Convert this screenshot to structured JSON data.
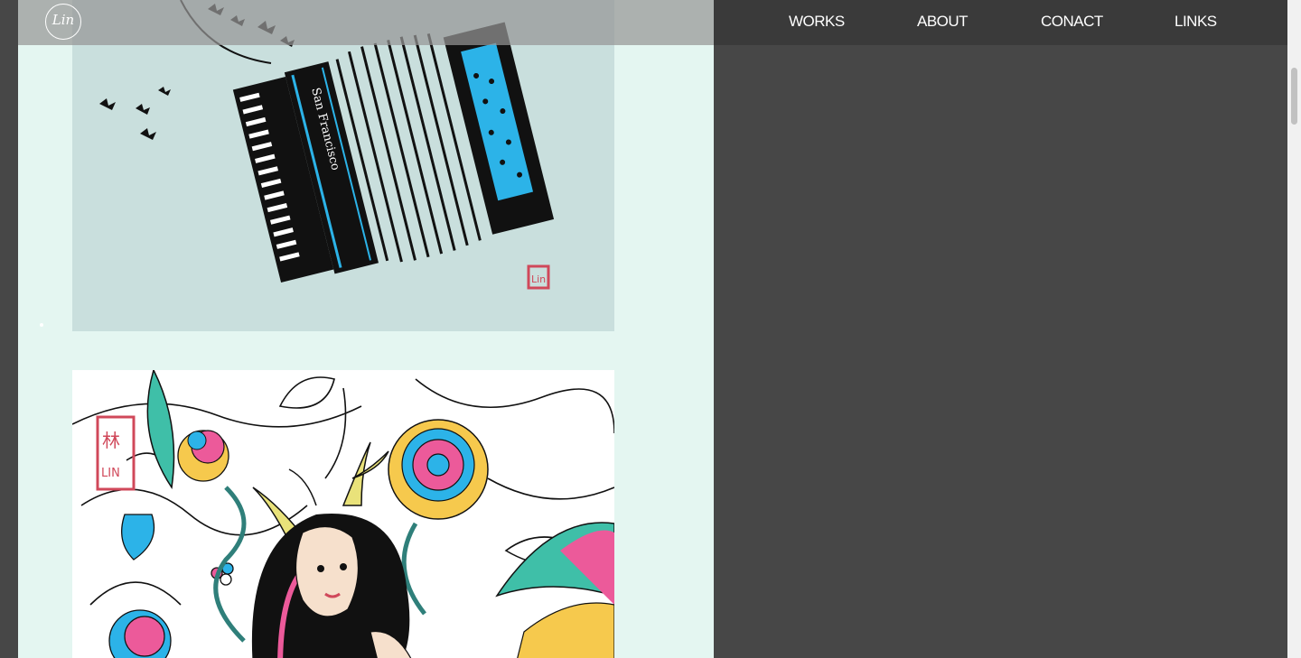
{
  "header": {
    "logo_text": "Lin",
    "nav": [
      {
        "label": "WORKS"
      },
      {
        "label": "ABOUT"
      },
      {
        "label": "CONACT"
      },
      {
        "label": "LINKS"
      }
    ]
  },
  "gallery": {
    "items": [
      {
        "subject": "accordion illustration",
        "printed_text": "San Francisco",
        "stamp": "Lin"
      },
      {
        "subject": "girl with antlers among flowers illustration",
        "stamp": "林 LIN"
      }
    ]
  },
  "colors": {
    "page_background": "#474747",
    "content_background": "#e4f6f1",
    "header_right": "#3a3a3a",
    "accent_blue": "#2cb3e8",
    "accent_pink": "#ec5a9a",
    "accent_yellow": "#f6c94d",
    "accent_teal": "#3fbfa8",
    "stamp_red": "#d0485a"
  },
  "icons": [
    "logo-icon",
    "scrollbar-thumb"
  ]
}
